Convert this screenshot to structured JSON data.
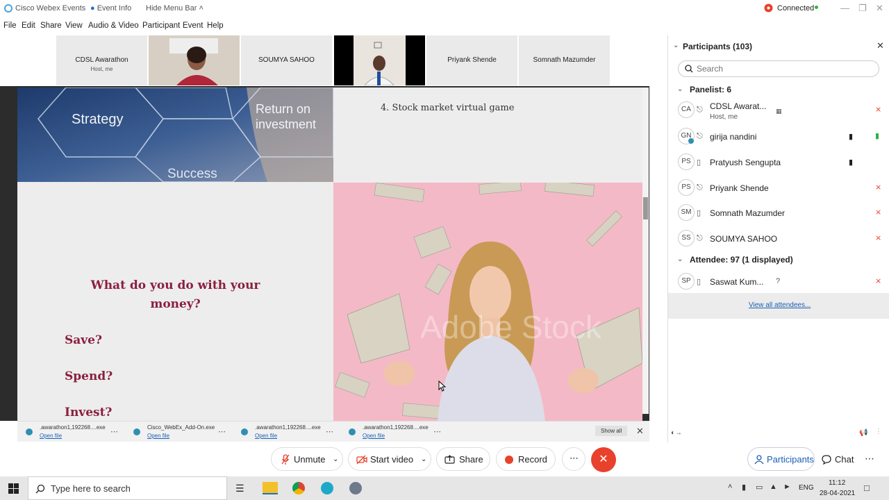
{
  "titlebar": {
    "app_name": "Cisco Webex Events",
    "event_info": "Event Info",
    "hide_menu": "Hide Menu Bar",
    "connection_status": "Connected",
    "status_color": "#2fb344"
  },
  "menu": [
    "File",
    "Edit",
    "Share",
    "View",
    "Audio & Video",
    "Participant",
    "Event",
    "Help"
  ],
  "video_strip": [
    {
      "name": "CDSL Awarathon",
      "sub": "Host, me"
    },
    {
      "name": "",
      "sub": ""
    },
    {
      "name": "SOUMYA SAHOO",
      "sub": ""
    },
    {
      "name": "",
      "sub": ""
    },
    {
      "name": "Priyank Shende",
      "sub": ""
    },
    {
      "name": "Somnath Mazumder",
      "sub": ""
    }
  ],
  "slide": {
    "image_words": {
      "strategy": "Strategy",
      "roi": "Return on investment",
      "success": "Success"
    },
    "list_item": "4. Stock market virtual game",
    "question": "What do you do with your money?",
    "options": [
      "Save?",
      "Spend?",
      "Invest?"
    ],
    "watermark": "Adobe Stock",
    "accent_color": "#8a1f3f"
  },
  "downloads": [
    {
      "file": ".awarathon1,192268....exe",
      "action": "Open file"
    },
    {
      "file": "Cisco_WebEx_Add-On.exe",
      "action": "Open file"
    },
    {
      "file": ".awarathon1,192268....exe",
      "action": "Open file"
    },
    {
      "file": ".awarathon1,192268....exe",
      "action": "Open file"
    }
  ],
  "download_show_all": "Show all",
  "controls": {
    "unmute": "Unmute",
    "start_video": "Start video",
    "share": "Share",
    "record": "Record",
    "participants": "Participants",
    "chat": "Chat",
    "leave_color": "#e8412c",
    "accent": "#1a5fb4"
  },
  "panel": {
    "title": "Participants (103)",
    "search_placeholder": "Search",
    "panelist_header": "Panelist: 6",
    "panelists": [
      {
        "initials": "CA",
        "name": "CDSL Awarat...",
        "sub": "Host, me"
      },
      {
        "initials": "GN",
        "name": "girija nandini",
        "sub": ""
      },
      {
        "initials": "PS",
        "name": "Pratyush Sengupta",
        "sub": ""
      },
      {
        "initials": "PS",
        "name": "Priyank Shende",
        "sub": ""
      },
      {
        "initials": "SM",
        "name": "Somnath Mazumder",
        "sub": ""
      },
      {
        "initials": "SS",
        "name": "SOUMYA SAHOO",
        "sub": ""
      }
    ],
    "attendee_header": "Attendee: 97 (1 displayed)",
    "attendees": [
      {
        "initials": "SP",
        "name": "Saswat Kum...",
        "note": "?"
      }
    ],
    "view_all": "View all attendees..."
  },
  "taskbar": {
    "search_placeholder": "Type here to search",
    "language": "ENG",
    "time": "11:12",
    "date": "28-04-2021"
  }
}
